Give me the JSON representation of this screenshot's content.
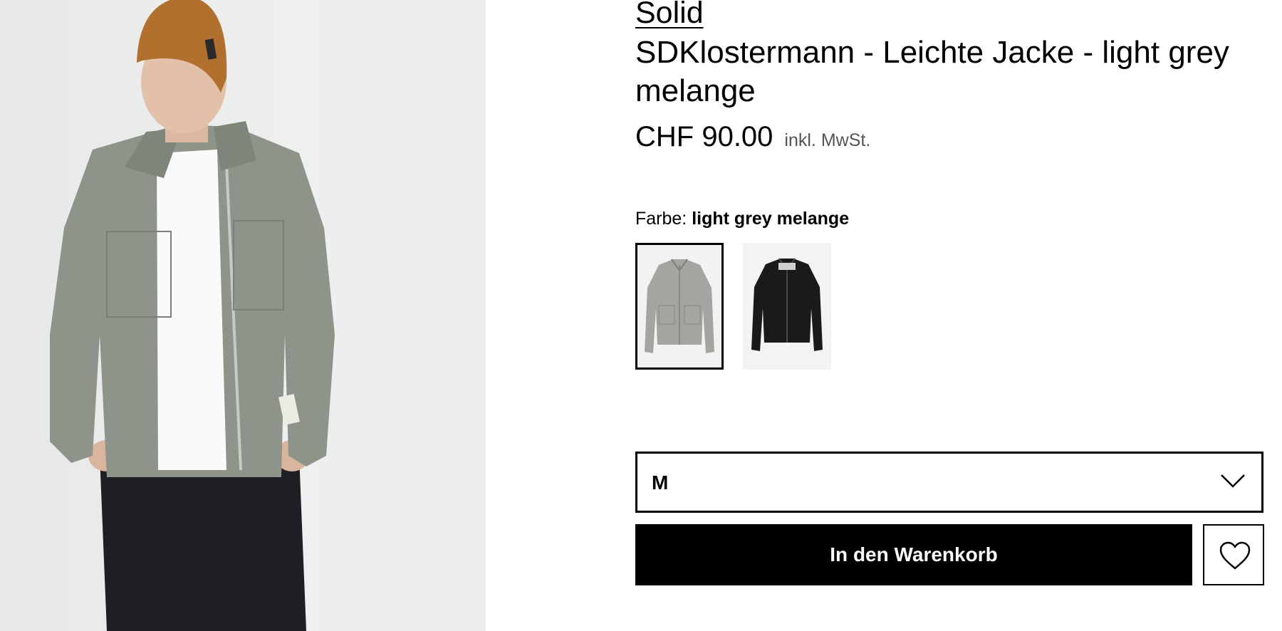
{
  "product": {
    "brand": "Solid",
    "title": "SDKlostermann - Leichte Jacke - light grey melange",
    "price": "CHF 90.00",
    "vat_note": "inkl. MwSt."
  },
  "color": {
    "label": "Farbe:",
    "selected": "light grey melange",
    "swatches": [
      {
        "name": "light grey melange",
        "hex": "#9fa39c",
        "selected": true
      },
      {
        "name": "black",
        "hex": "#1a1a1a",
        "selected": false
      }
    ]
  },
  "size": {
    "selected": "M",
    "icon": "chevron-down-icon"
  },
  "actions": {
    "add_to_cart_label": "In den Warenkorb",
    "wishlist_icon": "heart-icon"
  },
  "colors": {
    "jacket_green": "#8e948a",
    "beanie": "#b2702e",
    "trousers": "#1e1f24",
    "accent": "#000000"
  }
}
